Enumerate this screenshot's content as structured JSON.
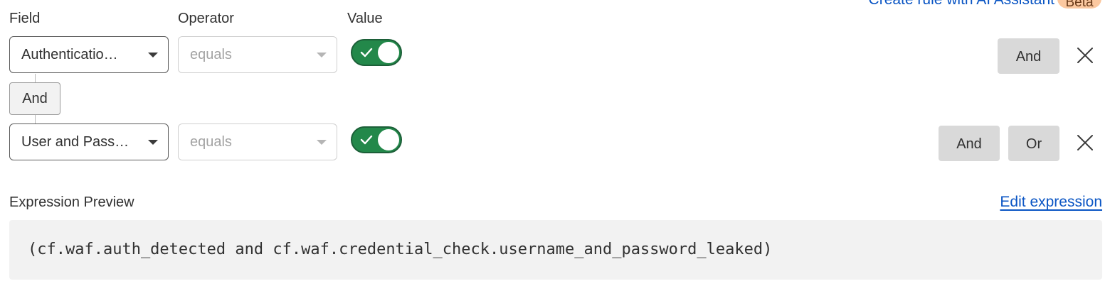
{
  "header": {
    "ai_link": "Create rule with AI Assistant",
    "beta_badge": "Beta"
  },
  "columns": {
    "field": "Field",
    "operator": "Operator",
    "value": "Value"
  },
  "rows": [
    {
      "field": "Authenticatio…",
      "operator": "equals",
      "value_on": true,
      "buttons": [
        "And"
      ]
    },
    {
      "field": "User and Pass…",
      "operator": "equals",
      "value_on": true,
      "buttons": [
        "And",
        "Or"
      ]
    }
  ],
  "connector_label": "And",
  "expression": {
    "label": "Expression Preview",
    "edit_link": "Edit expression",
    "text": "(cf.waf.auth_detected and cf.waf.credential_check.username_and_password_leaked)"
  },
  "colors": {
    "toggle_on": "#23884a",
    "link": "#0a55c4",
    "beta_bg": "#fbc8a0"
  },
  "icons": {
    "dropdown": "chevron-down-icon",
    "toggle_check": "check-icon",
    "remove": "close-icon"
  }
}
